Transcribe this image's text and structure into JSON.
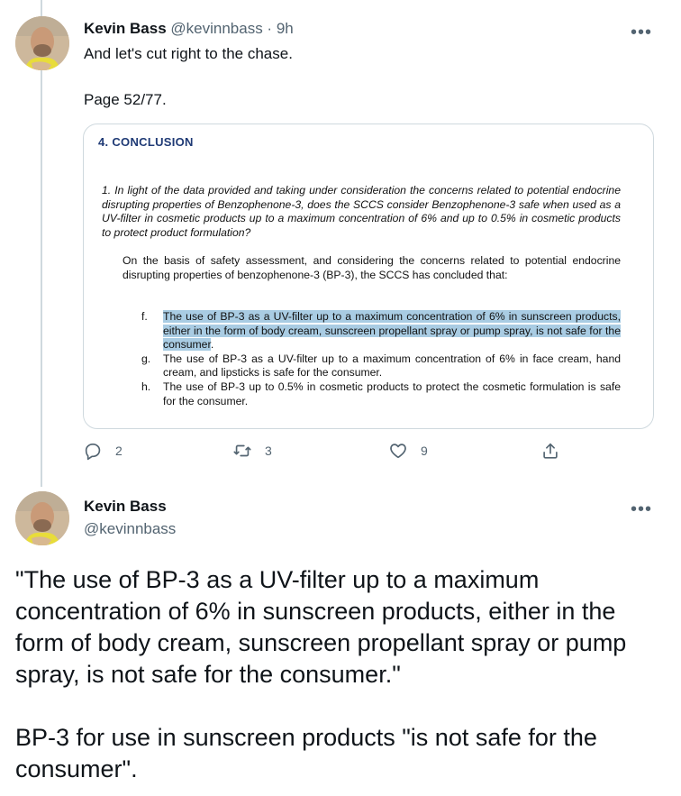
{
  "tweet1": {
    "name": "Kevin Bass",
    "handle": "@kevinnbass · 9h",
    "more": "•••",
    "text": "And let's cut right to the chase.",
    "text2": "Page 52/77.",
    "document": {
      "heading": "4.  CONCLUSION",
      "question": "1. In light of the data provided and taking under consideration the concerns related to potential endocrine disrupting properties of Benzophenone-3, does the SCCS consider Benzophenone-3 safe when used as a UV-filter in cosmetic products up to a maximum concentration of 6% and up to 0.5% in cosmetic products to protect product formulation?",
      "paragraph": "On the basis of safety assessment, and considering the concerns related to potential endocrine disrupting properties of benzophenone-3 (BP-3), the SCCS has concluded that:",
      "items": [
        {
          "letter": "f.",
          "highlight": "The use of BP-3 as a UV-filter up to a maximum concentration of 6% in sunscreen products, either in the form of body cream, sunscreen propellant spray or pump spray, is not safe for the consumer",
          "rest": "."
        },
        {
          "letter": "g.",
          "highlight": "",
          "rest": "The use of BP-3 as a UV-filter up to a maximum concentration of 6% in face cream, hand cream, and lipsticks is safe for the consumer."
        },
        {
          "letter": "h.",
          "highlight": "",
          "rest": "The use of BP-3 up to 0.5% in cosmetic products to protect the cosmetic formulation is safe for the consumer."
        }
      ],
      "highlight_color": "#a9cce3"
    },
    "actions": {
      "reply_count": "2",
      "retweet_count": "3",
      "like_count": "9",
      "reply_icon": "reply-icon",
      "retweet_icon": "retweet-icon",
      "like_icon": "heart-icon",
      "share_icon": "share-icon"
    }
  },
  "tweet2": {
    "name": "Kevin Bass",
    "handle": "@kevinnbass",
    "more": "•••",
    "paragraphs": [
      "\"The use of BP-3 as a UV-filter up to a maximum concentration of 6% in sunscreen products, either in the form of body cream, sunscreen propellant spray or pump spray, is not safe for the consumer.\"",
      "BP-3 for use in sunscreen products \"is not safe for the consumer\"."
    ]
  },
  "colors": {
    "text": "#0f1419",
    "secondary": "#536471",
    "border": "#cfd9de",
    "doc_heading": "#1f3a75"
  }
}
